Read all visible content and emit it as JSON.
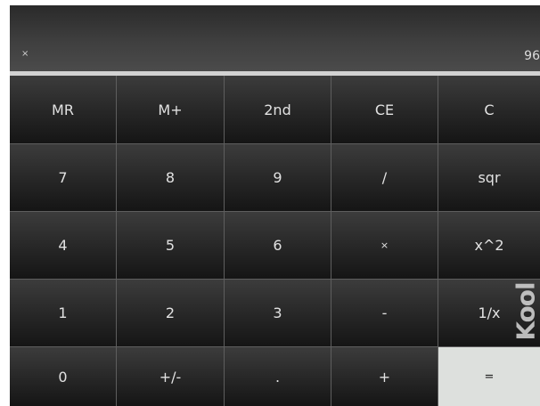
{
  "display": {
    "operator": "×",
    "value": "96"
  },
  "keys": [
    [
      {
        "label": "MR",
        "name": "memory-recall-button"
      },
      {
        "label": "M+",
        "name": "memory-add-button"
      },
      {
        "label": "2nd",
        "name": "second-function-button"
      },
      {
        "label": "CE",
        "name": "clear-entry-button"
      },
      {
        "label": "C",
        "name": "clear-button"
      }
    ],
    [
      {
        "label": "7",
        "name": "digit-7-button"
      },
      {
        "label": "8",
        "name": "digit-8-button"
      },
      {
        "label": "9",
        "name": "digit-9-button"
      },
      {
        "label": "/",
        "name": "divide-button"
      },
      {
        "label": "sqr",
        "name": "square-root-button"
      }
    ],
    [
      {
        "label": "4",
        "name": "digit-4-button"
      },
      {
        "label": "5",
        "name": "digit-5-button"
      },
      {
        "label": "6",
        "name": "digit-6-button"
      },
      {
        "label": "×",
        "name": "multiply-button"
      },
      {
        "label": "x^2",
        "name": "square-button"
      }
    ],
    [
      {
        "label": "1",
        "name": "digit-1-button"
      },
      {
        "label": "2",
        "name": "digit-2-button"
      },
      {
        "label": "3",
        "name": "digit-3-button"
      },
      {
        "label": "-",
        "name": "subtract-button"
      },
      {
        "label": "1/x",
        "name": "reciprocal-button"
      }
    ],
    [
      {
        "label": "0",
        "name": "digit-0-button"
      },
      {
        "label": "+/-",
        "name": "negate-button"
      },
      {
        "label": ".",
        "name": "decimal-point-button"
      },
      {
        "label": "+",
        "name": "add-button"
      },
      {
        "label": "=",
        "name": "equals-button"
      }
    ]
  ],
  "watermark": {
    "text": "Kool"
  },
  "colors": {
    "equals_key": "#dde0dd",
    "key_text": "#e2e2e2",
    "separator": "#d2d2d2"
  }
}
